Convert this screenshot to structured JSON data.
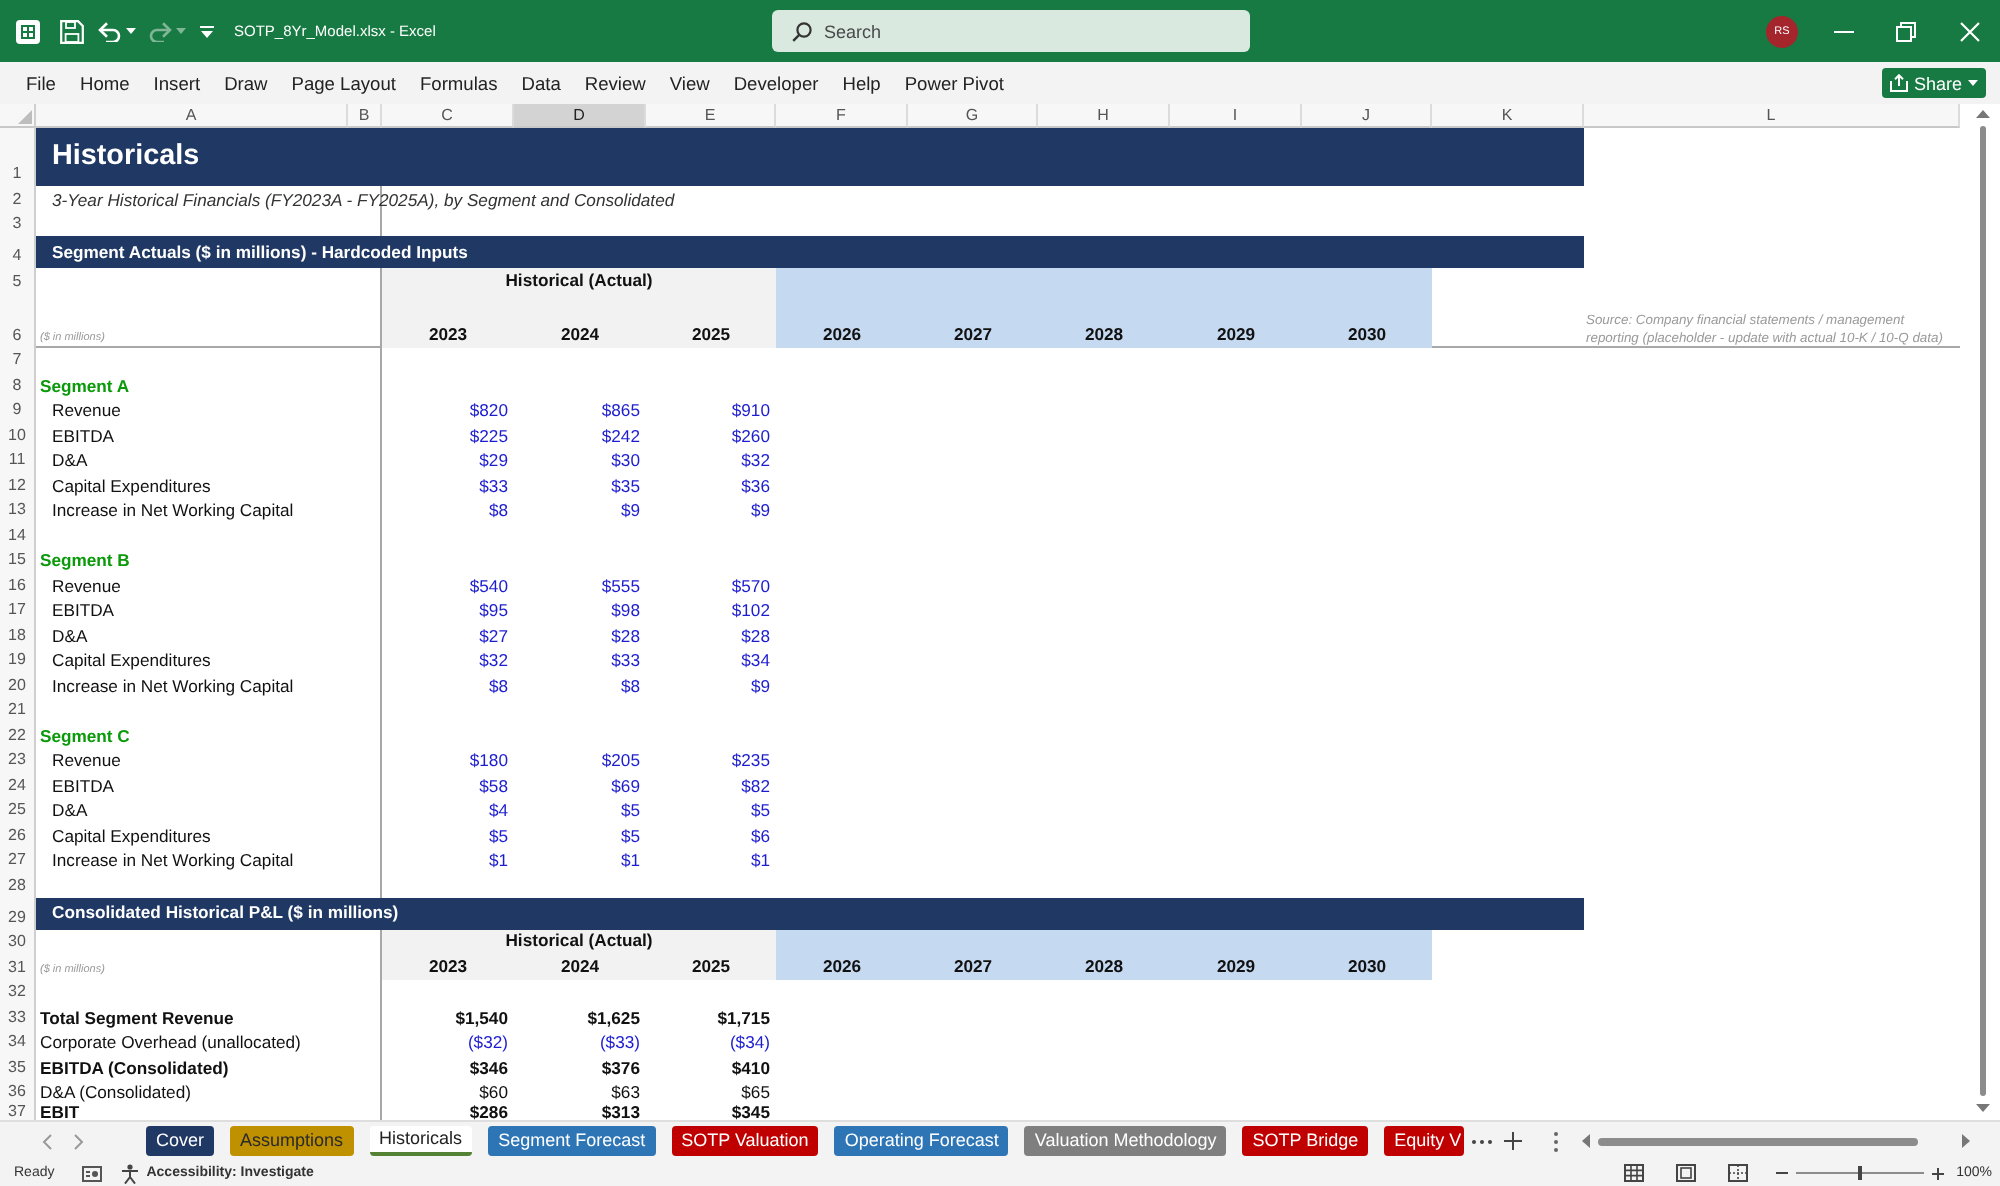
{
  "window": {
    "title": "SOTP_8Yr_Model.xlsx - Excel",
    "search_placeholder": "Search",
    "user_initials": "RS"
  },
  "menu": [
    "File",
    "Home",
    "Insert",
    "Draw",
    "Page Layout",
    "Formulas",
    "Data",
    "Review",
    "View",
    "Developer",
    "Help",
    "Power Pivot"
  ],
  "share_button": "Share",
  "columns": [
    {
      "label": "A",
      "selected": false
    },
    {
      "label": "B",
      "selected": false
    },
    {
      "label": "C",
      "selected": false
    },
    {
      "label": "D",
      "selected": true
    },
    {
      "label": "E",
      "selected": false
    },
    {
      "label": "F",
      "selected": false
    },
    {
      "label": "G",
      "selected": false
    },
    {
      "label": "H",
      "selected": false
    },
    {
      "label": "I",
      "selected": false
    },
    {
      "label": "J",
      "selected": false
    },
    {
      "label": "K",
      "selected": false
    },
    {
      "label": "L",
      "selected": false
    }
  ],
  "rows": [
    {
      "number": "1",
      "kind": "title",
      "text": "Historicals"
    },
    {
      "number": "2",
      "kind": "note",
      "text": "3-Year Historical Financials (FY2023A - FY2025A), by Segment and Consolidated"
    },
    {
      "number": "3",
      "kind": "blank"
    },
    {
      "number": "4",
      "kind": "section",
      "text": "Segment Actuals ($ in millions) - Hardcoded Inputs"
    },
    {
      "number": "5",
      "kind": "period",
      "text": "Historical (Actual)"
    },
    {
      "number": "6",
      "kind": "years",
      "unit": "($ in millions)",
      "years": [
        {
          "label": "2023",
          "forecast": false
        },
        {
          "label": "2024",
          "forecast": false
        },
        {
          "label": "2025",
          "forecast": false
        },
        {
          "label": "2026",
          "forecast": true
        },
        {
          "label": "2027",
          "forecast": true
        },
        {
          "label": "2028",
          "forecast": true
        },
        {
          "label": "2029",
          "forecast": true
        },
        {
          "label": "2030",
          "forecast": true
        }
      ],
      "source": "Source: Company financial statements / management reporting (placeholder - update with actual 10-K / 10-Q data)"
    },
    {
      "number": "7",
      "kind": "blank"
    },
    {
      "number": "8",
      "kind": "segment",
      "text": "Segment A"
    },
    {
      "number": "9",
      "kind": "item",
      "label": "Revenue",
      "values": [
        "$820",
        "$865",
        "$910"
      ],
      "bold": false,
      "input": true
    },
    {
      "number": "10",
      "kind": "item",
      "label": "EBITDA",
      "values": [
        "$225",
        "$242",
        "$260"
      ],
      "bold": false,
      "input": true
    },
    {
      "number": "11",
      "kind": "item",
      "label": "D&A",
      "values": [
        "$29",
        "$30",
        "$32"
      ],
      "bold": false,
      "input": true
    },
    {
      "number": "12",
      "kind": "item",
      "label": "Capital Expenditures",
      "values": [
        "$33",
        "$35",
        "$36"
      ],
      "bold": false,
      "input": true
    },
    {
      "number": "13",
      "kind": "item",
      "label": "Increase in Net Working Capital",
      "values": [
        "$8",
        "$9",
        "$9"
      ],
      "bold": false,
      "input": true
    },
    {
      "number": "14",
      "kind": "blank"
    },
    {
      "number": "15",
      "kind": "segment",
      "text": "Segment B"
    },
    {
      "number": "16",
      "kind": "item",
      "label": "Revenue",
      "values": [
        "$540",
        "$555",
        "$570"
      ],
      "bold": false,
      "input": true
    },
    {
      "number": "17",
      "kind": "item",
      "label": "EBITDA",
      "values": [
        "$95",
        "$98",
        "$102"
      ],
      "bold": false,
      "input": true
    },
    {
      "number": "18",
      "kind": "item",
      "label": "D&A",
      "values": [
        "$27",
        "$28",
        "$28"
      ],
      "bold": false,
      "input": true
    },
    {
      "number": "19",
      "kind": "item",
      "label": "Capital Expenditures",
      "values": [
        "$32",
        "$33",
        "$34"
      ],
      "bold": false,
      "input": true
    },
    {
      "number": "20",
      "kind": "item",
      "label": "Increase in Net Working Capital",
      "values": [
        "$8",
        "$8",
        "$9"
      ],
      "bold": false,
      "input": true
    },
    {
      "number": "21",
      "kind": "blank"
    },
    {
      "number": "22",
      "kind": "segment",
      "text": "Segment C"
    },
    {
      "number": "23",
      "kind": "item",
      "label": "Revenue",
      "values": [
        "$180",
        "$205",
        "$235"
      ],
      "bold": false,
      "input": true
    },
    {
      "number": "24",
      "kind": "item",
      "label": "EBITDA",
      "values": [
        "$58",
        "$69",
        "$82"
      ],
      "bold": false,
      "input": true
    },
    {
      "number": "25",
      "kind": "item",
      "label": "D&A",
      "values": [
        "$4",
        "$5",
        "$5"
      ],
      "bold": false,
      "input": true
    },
    {
      "number": "26",
      "kind": "item",
      "label": "Capital Expenditures",
      "values": [
        "$5",
        "$5",
        "$6"
      ],
      "bold": false,
      "input": true
    },
    {
      "number": "27",
      "kind": "item",
      "label": "Increase in Net Working Capital",
      "values": [
        "$1",
        "$1",
        "$1"
      ],
      "bold": false,
      "input": true
    },
    {
      "number": "28",
      "kind": "blank"
    },
    {
      "number": "29",
      "kind": "section",
      "text": "Consolidated Historical P&L ($ in millions)"
    },
    {
      "number": "30",
      "kind": "period",
      "text": "Historical (Actual)"
    },
    {
      "number": "31",
      "kind": "years",
      "unit": "($ in millions)",
      "years": [
        {
          "label": "2023",
          "forecast": false
        },
        {
          "label": "2024",
          "forecast": false
        },
        {
          "label": "2025",
          "forecast": false
        },
        {
          "label": "2026",
          "forecast": true
        },
        {
          "label": "2027",
          "forecast": true
        },
        {
          "label": "2028",
          "forecast": true
        },
        {
          "label": "2029",
          "forecast": true
        },
        {
          "label": "2030",
          "forecast": true
        }
      ]
    },
    {
      "number": "32",
      "kind": "blank"
    },
    {
      "number": "33",
      "kind": "line",
      "label": "Total Segment Revenue",
      "values": [
        "$1,540",
        "$1,625",
        "$1,715"
      ],
      "bold": true,
      "input": false
    },
    {
      "number": "34",
      "kind": "line",
      "label": "Corporate Overhead (unallocated)",
      "values": [
        "($32)",
        "($33)",
        "($34)"
      ],
      "bold": false,
      "input": true
    },
    {
      "number": "35",
      "kind": "line",
      "label": "EBITDA (Consolidated)",
      "values": [
        "$346",
        "$376",
        "$410"
      ],
      "bold": true,
      "input": false
    },
    {
      "number": "36",
      "kind": "line",
      "label": "D&A (Consolidated)",
      "values": [
        "$60",
        "$63",
        "$65"
      ],
      "bold": false,
      "input": false
    },
    {
      "number": "37",
      "kind": "line",
      "label": "EBIT",
      "values": [
        "$286",
        "$313",
        "$345"
      ],
      "bold": true,
      "input": false
    }
  ],
  "sheet_tabs": [
    {
      "label": "Cover",
      "color": "#203864",
      "selected": false
    },
    {
      "label": "Assumptions",
      "color": "#bf9000",
      "selected": false
    },
    {
      "label": "Historicals",
      "color": "#548235",
      "selected": true
    },
    {
      "label": "Segment Forecast",
      "color": "#2e75b6",
      "selected": false
    },
    {
      "label": "SOTP Valuation",
      "color": "#c00000",
      "selected": false
    },
    {
      "label": "Operating Forecast",
      "color": "#2e75b6",
      "selected": false
    },
    {
      "label": "Valuation Methodology",
      "color": "#7f7f7f",
      "selected": false
    },
    {
      "label": "SOTP Bridge",
      "color": "#c00000",
      "selected": false
    },
    {
      "label": "Equity V",
      "color": "#c00000",
      "selected": false
    }
  ],
  "status_bar": {
    "status": "Ready",
    "accessibility": "Accessibility: Investigate",
    "zoom_slider": {
      "level": 0.5
    },
    "zoom": "100%"
  }
}
